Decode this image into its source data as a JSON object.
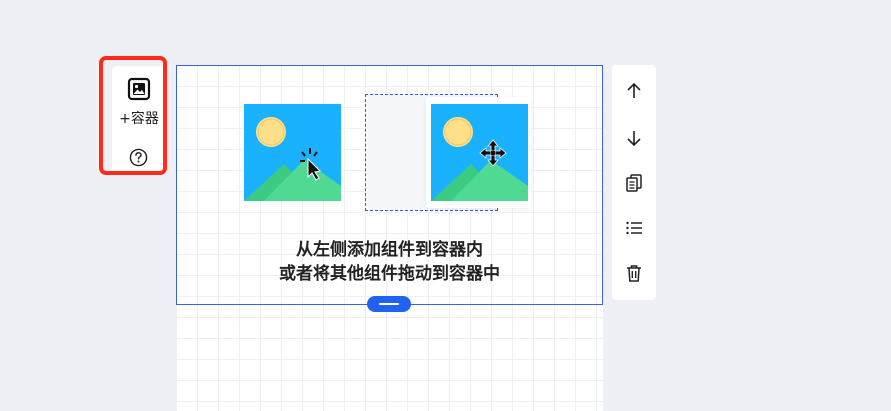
{
  "left_tool": {
    "add_container_label": "+容器",
    "image_icon": "image-icon",
    "help_icon": "question-circle-icon",
    "highlight_color": "#ff2a1a"
  },
  "canvas": {
    "hint_line_1": "从左侧添加组件到容器内",
    "hint_line_2": "或者将其他组件拖动到容器中",
    "accent_color": "#2262ee",
    "illustration_sky": "#1ab1ff",
    "illustration_sun": "#ffe08a",
    "illustration_hill": "#4fd992"
  },
  "right_toolbar": {
    "buttons": [
      "arrow-up-icon",
      "arrow-down-icon",
      "copy-icon",
      "list-icon",
      "trash-icon"
    ]
  }
}
